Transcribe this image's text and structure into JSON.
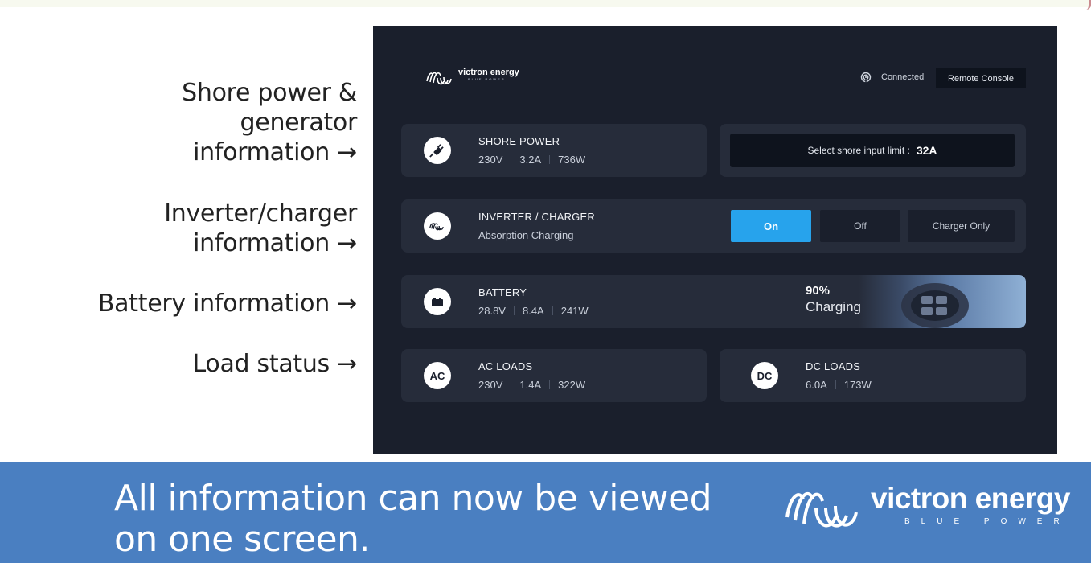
{
  "annotations": {
    "shore_power": [
      "Shore power &",
      "generator",
      "information →"
    ],
    "inverter": [
      "Inverter/charger",
      "information →"
    ],
    "battery": [
      "Battery information →"
    ],
    "loads": [
      "Load status →"
    ]
  },
  "header": {
    "brand_name": "victron energy",
    "brand_tagline": "BLUE POWER",
    "connection_status": "Connected",
    "remote_console_label": "Remote Console"
  },
  "shore_power": {
    "title": "SHORE POWER",
    "voltage": "230V",
    "current": "3.2A",
    "power": "736W",
    "icon": "plug-icon"
  },
  "shore_limit": {
    "label": "Select shore input limit :",
    "value": "32A"
  },
  "inverter_charger": {
    "title": "INVERTER / CHARGER",
    "state": "Absorption Charging",
    "icon": "victron-logo-icon",
    "modes": [
      "On",
      "Off",
      "Charger Only"
    ],
    "active_mode": "On"
  },
  "battery": {
    "title": "BATTERY",
    "voltage": "28.8V",
    "current": "8.4A",
    "power": "241W",
    "soc": "90%",
    "state": "Charging",
    "icon": "battery-icon"
  },
  "ac_loads": {
    "title": "AC LOADS",
    "icon_label": "AC",
    "voltage": "230V",
    "current": "1.4A",
    "power": "322W"
  },
  "dc_loads": {
    "title": "DC LOADS",
    "icon_label": "DC",
    "current": "6.0A",
    "power": "173W"
  },
  "banner": {
    "lines": [
      "All information can now be viewed",
      "on one screen."
    ],
    "brand_name": "victron energy",
    "brand_tagline": "BLUE POWER"
  },
  "colors": {
    "console_bg": "#1a1f2c",
    "card_bg": "#262c3a",
    "accent": "#27a3ec",
    "banner_bg": "#4a7fc1"
  }
}
